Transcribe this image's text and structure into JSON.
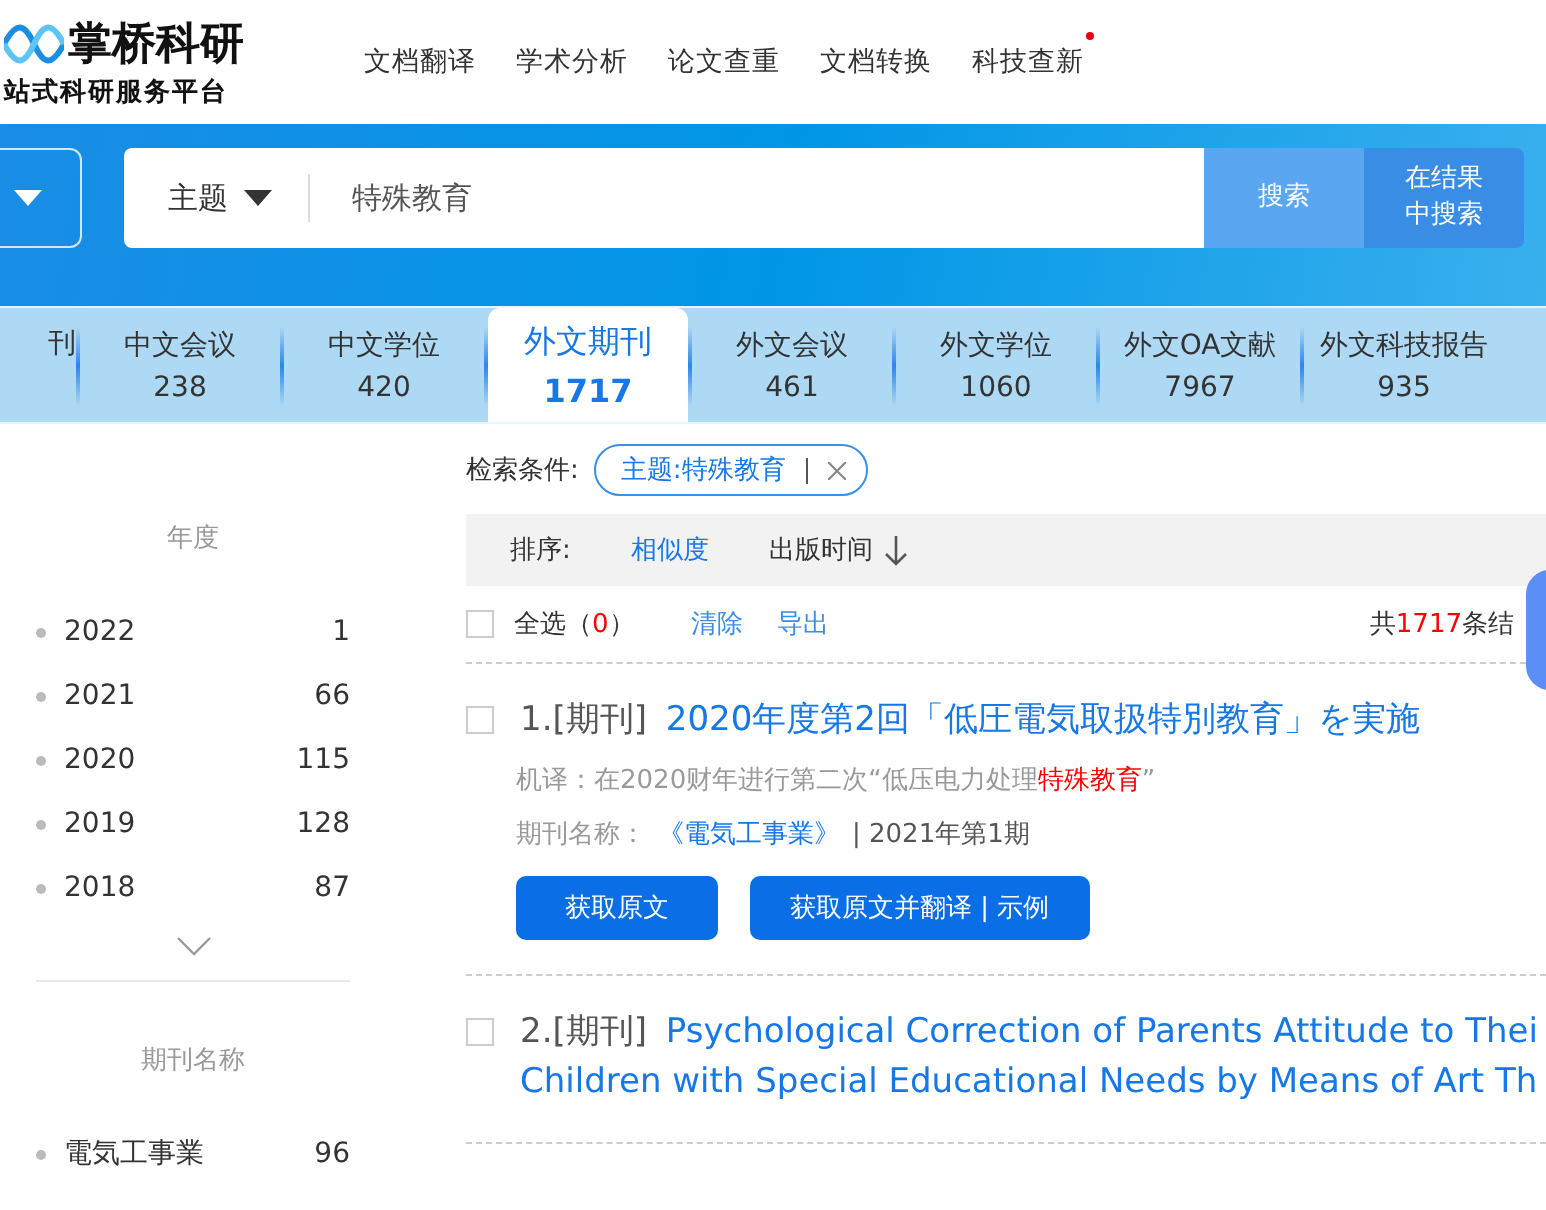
{
  "logo": {
    "name": "掌桥科研",
    "slogan": "站式科研服务平台"
  },
  "nav": [
    {
      "label": "文档翻译",
      "new": false
    },
    {
      "label": "学术分析",
      "new": false
    },
    {
      "label": "论文查重",
      "new": false
    },
    {
      "label": "文档转换",
      "new": false
    },
    {
      "label": "科技查新",
      "new": true
    }
  ],
  "search": {
    "field": "主题",
    "value": "特殊教育",
    "buttons": [
      "搜索",
      "在结果中搜索"
    ]
  },
  "tabs": [
    {
      "label": "刊",
      "selected": false
    },
    {
      "label": "中文会议",
      "count": "238",
      "selected": false
    },
    {
      "label": "中文学位",
      "count": "420",
      "selected": false
    },
    {
      "label": "外文期刊",
      "count": "1717",
      "selected": true
    },
    {
      "label": "外文会议",
      "count": "461",
      "selected": false
    },
    {
      "label": "外文学位",
      "count": "1060",
      "selected": false
    },
    {
      "label": "外文OA文献",
      "count": "7967",
      "selected": false
    },
    {
      "label": "外文科技报告",
      "count": "935",
      "selected": false
    }
  ],
  "sidebar": [
    {
      "heading": "年度",
      "items": [
        {
          "label": "2022",
          "count": "1"
        },
        {
          "label": "2021",
          "count": "66"
        },
        {
          "label": "2020",
          "count": "115"
        },
        {
          "label": "2019",
          "count": "128"
        },
        {
          "label": "2018",
          "count": "87"
        }
      ],
      "more": true
    },
    {
      "heading": "期刊名称",
      "items": [
        {
          "label": "電気工事業",
          "count": "96"
        }
      ],
      "more": false
    }
  ],
  "conditions": {
    "label": "检索条件:",
    "tags": [
      "主题:特殊教育"
    ]
  },
  "sort": {
    "label": "排序:",
    "options": [
      {
        "label": "相似度",
        "selected": true,
        "arrow": false
      },
      {
        "label": "出版时间",
        "selected": false,
        "arrow": true
      }
    ]
  },
  "toolbar": {
    "select_all": "全选",
    "selected_count": "（**0**）",
    "checked": false,
    "actions": [
      "清除",
      "导出"
    ],
    "total_prefix": "共",
    "total": "1717",
    "total_suffix": "条结"
  },
  "results": [
    {
      "checked": false,
      "index": "1.[期刊]",
      "title_lines": [
        "2020年度第2回「低圧電気取扱特別教育」を実施"
      ],
      "translation": "机译：在2020财年进行第二次“低压电力处理**特殊教育**”",
      "journal_label": "期刊名称：",
      "journal": "《電気工事業》",
      "issue": "| 2021年第1期",
      "buttons": [
        "获取原文",
        "获取原文并翻译 | 示例"
      ]
    },
    {
      "checked": false,
      "index": "2.[期刊]",
      "title_lines": [
        "Psychological Correction of Parents Attitude to Thei",
        "Children with Special Educational Needs by Means of Art Th"
      ]
    }
  ]
}
